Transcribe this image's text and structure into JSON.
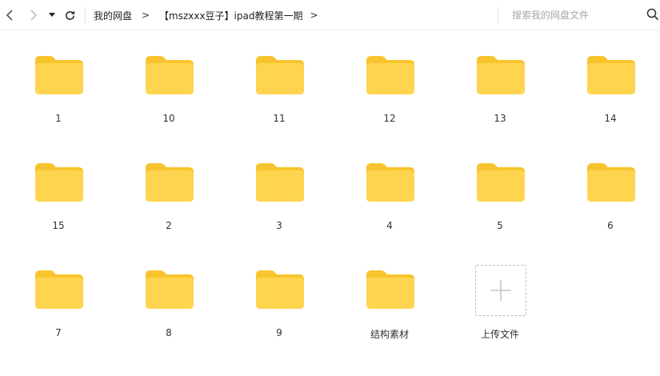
{
  "nav": {
    "back_icon": "chevron-left-icon",
    "forward_icon": "chevron-right-icon",
    "history_icon": "caret-down-icon",
    "refresh_icon": "refresh-icon"
  },
  "breadcrumb": {
    "items": [
      "我的网盘",
      "【mszxxx豆子】ipad教程第一期"
    ],
    "separator": ">"
  },
  "search": {
    "placeholder": "搜索我的网盘文件",
    "icon": "search-icon"
  },
  "folders": [
    {
      "name": "1"
    },
    {
      "name": "10"
    },
    {
      "name": "11"
    },
    {
      "name": "12"
    },
    {
      "name": "13"
    },
    {
      "name": "14"
    },
    {
      "name": "15"
    },
    {
      "name": "2"
    },
    {
      "name": "3"
    },
    {
      "name": "4"
    },
    {
      "name": "5"
    },
    {
      "name": "6"
    },
    {
      "name": "7"
    },
    {
      "name": "8"
    },
    {
      "name": "9"
    },
    {
      "name": "结构素材"
    }
  ],
  "upload": {
    "label": "上传文件",
    "icon": "plus-icon"
  },
  "colors": {
    "folder_front": "#FFD54F",
    "folder_back": "#F8C42E",
    "accent": "#333333"
  }
}
